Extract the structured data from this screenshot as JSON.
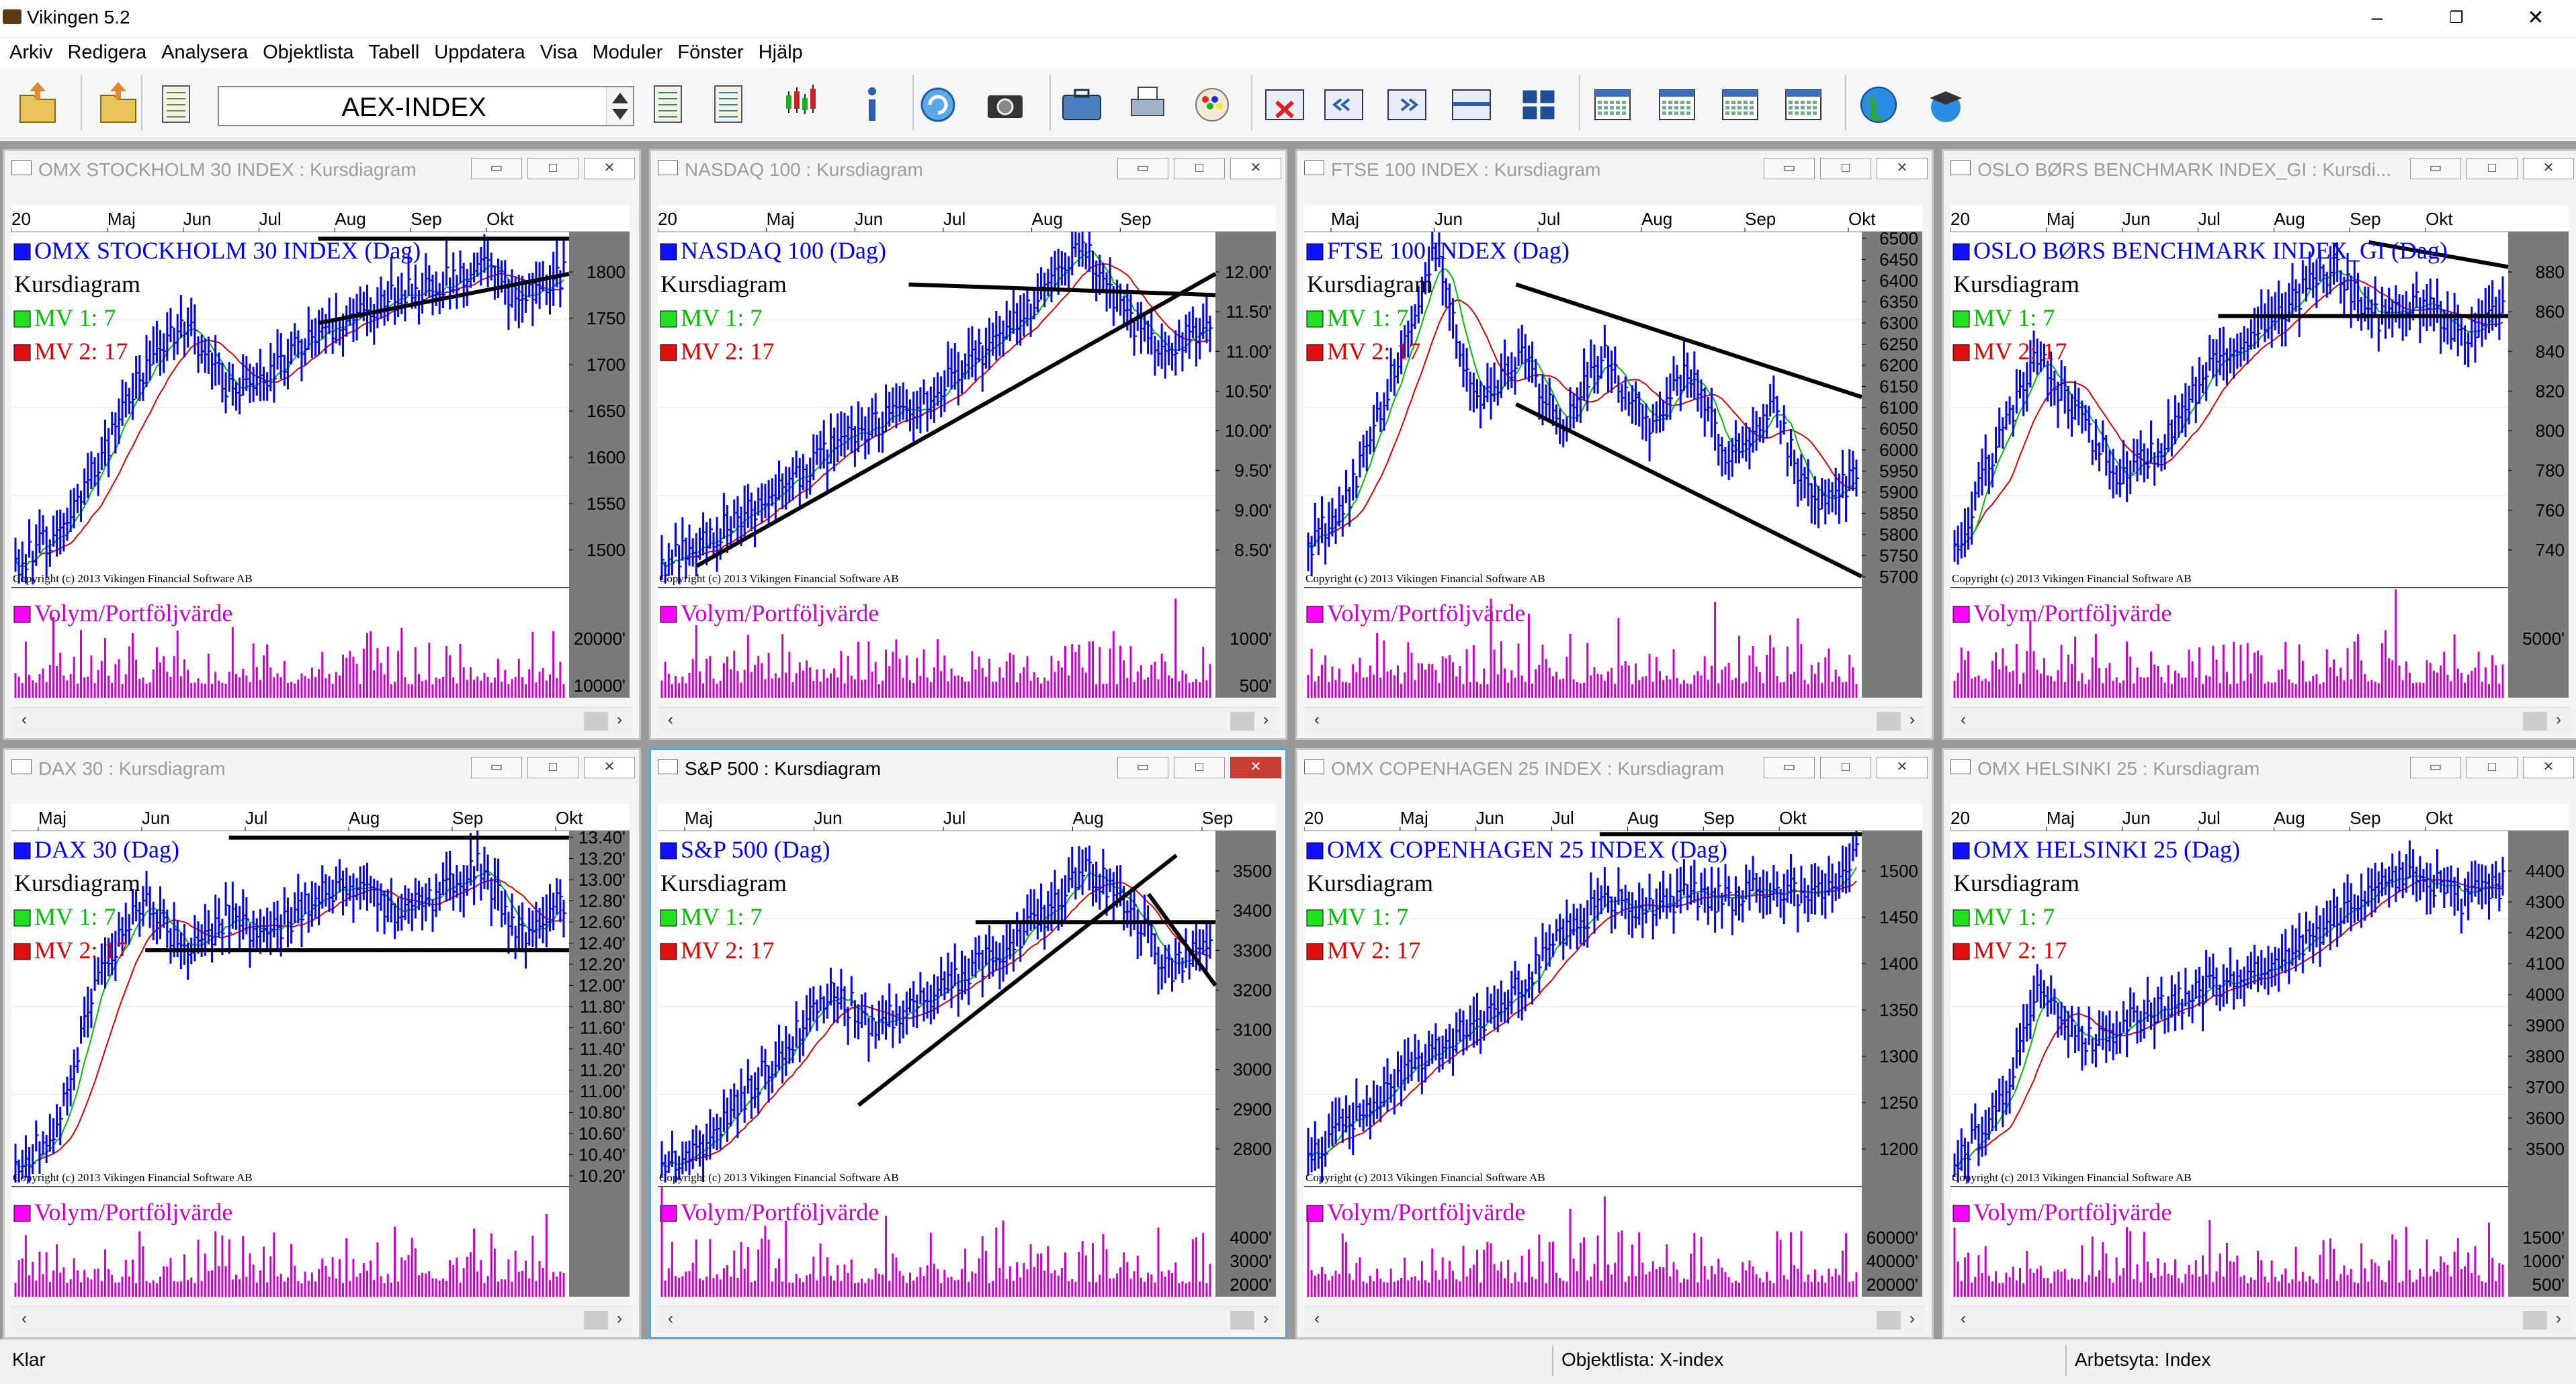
{
  "app": {
    "title": "Vikingen 5.2"
  },
  "menu": [
    "Arkiv",
    "Redigera",
    "Analysera",
    "Objektlista",
    "Tabell",
    "Uppdatera",
    "Visa",
    "Moduler",
    "Fönster",
    "Hjälp"
  ],
  "toolbar": {
    "symbol": "AEX-INDEX",
    "icons": [
      "open-folder-icon",
      "upload-folder-icon",
      "object-list-icon",
      "chart-edit-icon",
      "list-search-icon",
      "candlestick-icon",
      "info-icon",
      "refresh-icon",
      "camera-icon",
      "briefcase-icon",
      "printer-icon",
      "palette-icon",
      "delete-window-icon",
      "previous-icon",
      "next-icon",
      "tile-horizontal-icon",
      "tile-grid-icon",
      "calendar-day-icon",
      "calendar-week-icon",
      "calendar-month-icon",
      "calendar-edit-icon",
      "globe-icon",
      "graduation-icon"
    ]
  },
  "colors": {
    "price": "#0000ff",
    "ma1": "#00c000",
    "ma2": "#e00000",
    "volume": "#cc00cc",
    "legend_text": "#0000ff",
    "axis_bg": "#7a7a7a",
    "trend": "#000000"
  },
  "common": {
    "subtitle": "Kursdiagram",
    "ma1": "MV 1: 7",
    "ma2": "MV 2: 17",
    "volume_label": "Volym/Portföljvärde",
    "copyright": "Copyright (c) 2013 Vikingen Financial Software AB"
  },
  "windows": [
    {
      "title": "OMX STOCKHOLM 30 INDEX : Kursdiagram",
      "legend": "OMX STOCKHOLM 30 INDEX (Dag)",
      "months": [
        "20",
        "Maj",
        "Jun",
        "Jul",
        "Aug",
        "Sep",
        "Okt"
      ],
      "price_ticks": [
        "1800",
        "1750",
        "1700",
        "1650",
        "1600",
        "1550",
        "1500"
      ],
      "vol_ticks": [
        "20000'",
        "10000'"
      ],
      "active": false
    },
    {
      "title": "NASDAQ 100 : Kursdiagram",
      "legend": "NASDAQ 100 (Dag)",
      "months": [
        "20",
        "Maj",
        "Jun",
        "Jul",
        "Aug",
        "Sep"
      ],
      "price_ticks": [
        "12.00'",
        "11.50'",
        "11.00'",
        "10.50'",
        "10.00'",
        "9.50'",
        "9.00'",
        "8.50'"
      ],
      "vol_ticks": [
        "1000'",
        "500'"
      ],
      "active": false
    },
    {
      "title": "FTSE 100 INDEX : Kursdiagram",
      "legend": "FTSE 100 INDEX (Dag)",
      "months": [
        "Maj",
        "Jun",
        "Jul",
        "Aug",
        "Sep",
        "Okt"
      ],
      "price_ticks": [
        "6500",
        "6450",
        "6400",
        "6350",
        "6300",
        "6250",
        "6200",
        "6150",
        "6100",
        "6050",
        "6000",
        "5950",
        "5900",
        "5850",
        "5800",
        "5750",
        "5700"
      ],
      "vol_ticks": [],
      "active": false
    },
    {
      "title": "OSLO BØRS BENCHMARK INDEX_GI : Kursdi...",
      "legend": "OSLO BØRS BENCHMARK INDEX_GI (Dag)",
      "months": [
        "20",
        "Maj",
        "Jun",
        "Jul",
        "Aug",
        "Sep",
        "Okt"
      ],
      "price_ticks": [
        "880",
        "860",
        "840",
        "820",
        "800",
        "780",
        "760",
        "740"
      ],
      "vol_ticks": [
        "5000'"
      ],
      "active": false
    },
    {
      "title": "DAX 30 : Kursdiagram",
      "legend": "DAX 30 (Dag)",
      "months": [
        "Maj",
        "Jun",
        "Jul",
        "Aug",
        "Sep",
        "Okt"
      ],
      "price_ticks": [
        "13.40'",
        "13.20'",
        "13.00'",
        "12.80'",
        "12.60'",
        "12.40'",
        "12.20'",
        "12.00'",
        "11.80'",
        "11.60'",
        "11.40'",
        "11.20'",
        "11.00'",
        "10.80'",
        "10.60'",
        "10.40'",
        "10.20'"
      ],
      "vol_ticks": [],
      "active": false
    },
    {
      "title": "S&P 500 : Kursdiagram",
      "legend": "S&P 500 (Dag)",
      "months": [
        "Maj",
        "Jun",
        "Jul",
        "Aug",
        "Sep"
      ],
      "price_ticks": [
        "3500",
        "3400",
        "3300",
        "3200",
        "3100",
        "3000",
        "2900",
        "2800"
      ],
      "vol_ticks": [
        "4000'",
        "3000'",
        "2000'"
      ],
      "active": true
    },
    {
      "title": "OMX COPENHAGEN 25 INDEX : Kursdiagram",
      "legend": "OMX COPENHAGEN 25 INDEX (Dag)",
      "months": [
        "20",
        "Maj",
        "Jun",
        "Jul",
        "Aug",
        "Sep",
        "Okt"
      ],
      "price_ticks": [
        "1500",
        "1450",
        "1400",
        "1350",
        "1300",
        "1250",
        "1200"
      ],
      "vol_ticks": [
        "60000'",
        "40000'",
        "20000'"
      ],
      "active": false
    },
    {
      "title": "OMX HELSINKI 25 : Kursdiagram",
      "legend": "OMX HELSINKI 25 (Dag)",
      "months": [
        "20",
        "Maj",
        "Jun",
        "Jul",
        "Aug",
        "Sep",
        "Okt"
      ],
      "price_ticks": [
        "4400",
        "4300",
        "4200",
        "4100",
        "4000",
        "3900",
        "3800",
        "3700",
        "3600",
        "3500"
      ],
      "vol_ticks": [
        "1500'",
        "1000'",
        "500'"
      ],
      "active": false
    }
  ],
  "status": {
    "left": "Klar",
    "objektlista": "Objektlista: X-index",
    "arbetsyta": "Arbetsyta: Index"
  }
}
